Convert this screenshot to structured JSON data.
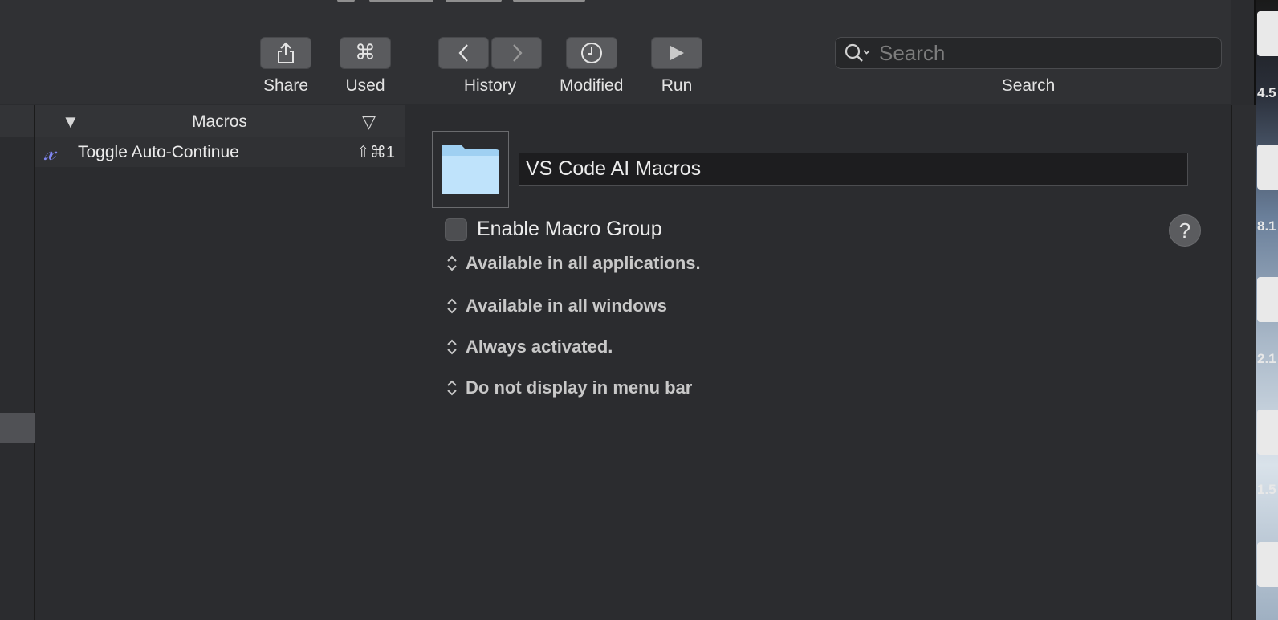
{
  "toolbar": {
    "share_label": "Share",
    "used_label": "Used",
    "history_label": "History",
    "modified_label": "Modified",
    "run_label": "Run",
    "search_label": "Search",
    "search_placeholder": "Search"
  },
  "macros_column": {
    "header": "Macros",
    "items": [
      {
        "name": "Toggle Auto-Continue",
        "hotkey": "⇧⌘1"
      }
    ]
  },
  "editor": {
    "group_name": "VS Code AI Macros",
    "enable_label": "Enable Macro Group",
    "enabled": false,
    "help_label": "?",
    "popups": [
      "Available in all applications.",
      "Available in all windows",
      "Always activated.",
      "Do not display in menu bar"
    ]
  },
  "desktop": {
    "labels": [
      "4.5",
      "8.1",
      "2.1",
      "1.5"
    ]
  },
  "colors": {
    "accent_macro_icon": "#7f86f2",
    "folder_icon": "#bfe3fb"
  }
}
